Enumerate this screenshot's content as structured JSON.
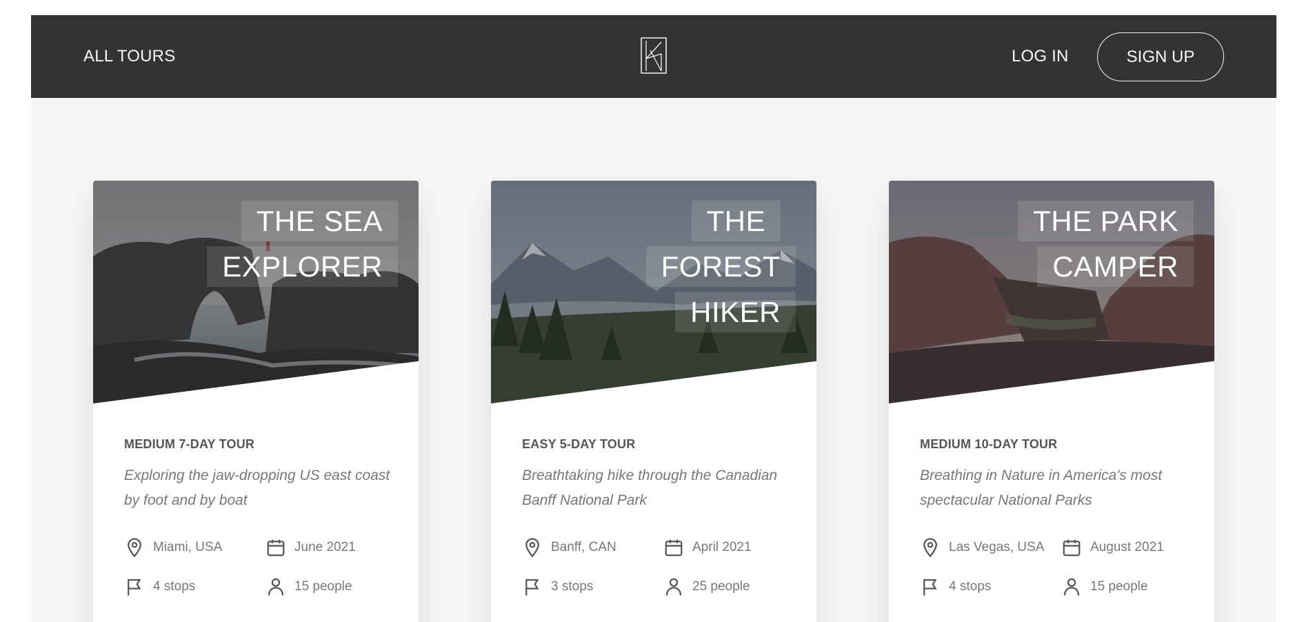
{
  "header": {
    "all_tours": "ALL TOURS",
    "log_in": "LOG IN",
    "sign_up": "SIGN UP"
  },
  "tours": [
    {
      "title_line1": "THE SEA",
      "title_line2": "EXPLORER",
      "subheading": "MEDIUM 7-DAY TOUR",
      "summary": "Exploring the jaw-dropping US east coast by foot and by boat",
      "location": "Miami, USA",
      "date": "June 2021",
      "stops": "4 stops",
      "people": "15 people"
    },
    {
      "title_line1": "THE FOREST",
      "title_line2": "HIKER",
      "subheading": "EASY 5-DAY TOUR",
      "summary": "Breathtaking hike through the Canadian Banff National Park",
      "location": "Banff, CAN",
      "date": "April 2021",
      "stops": "3 stops",
      "people": "25 people"
    },
    {
      "title_line1": "THE PARK",
      "title_line2": "CAMPER",
      "subheading": "MEDIUM 10-DAY TOUR",
      "summary": "Breathing in Nature in America's most spectacular National Parks",
      "location": "Las Vegas, USA",
      "date": "August 2021",
      "stops": "4 stops",
      "people": "15 people"
    }
  ],
  "colors": {
    "header_bg": "#333333",
    "page_bg": "#f6f6f6",
    "card_bg": "#ffffff"
  },
  "icons": [
    "logo-icon",
    "map-pin-icon",
    "calendar-icon",
    "flag-icon",
    "user-icon"
  ]
}
